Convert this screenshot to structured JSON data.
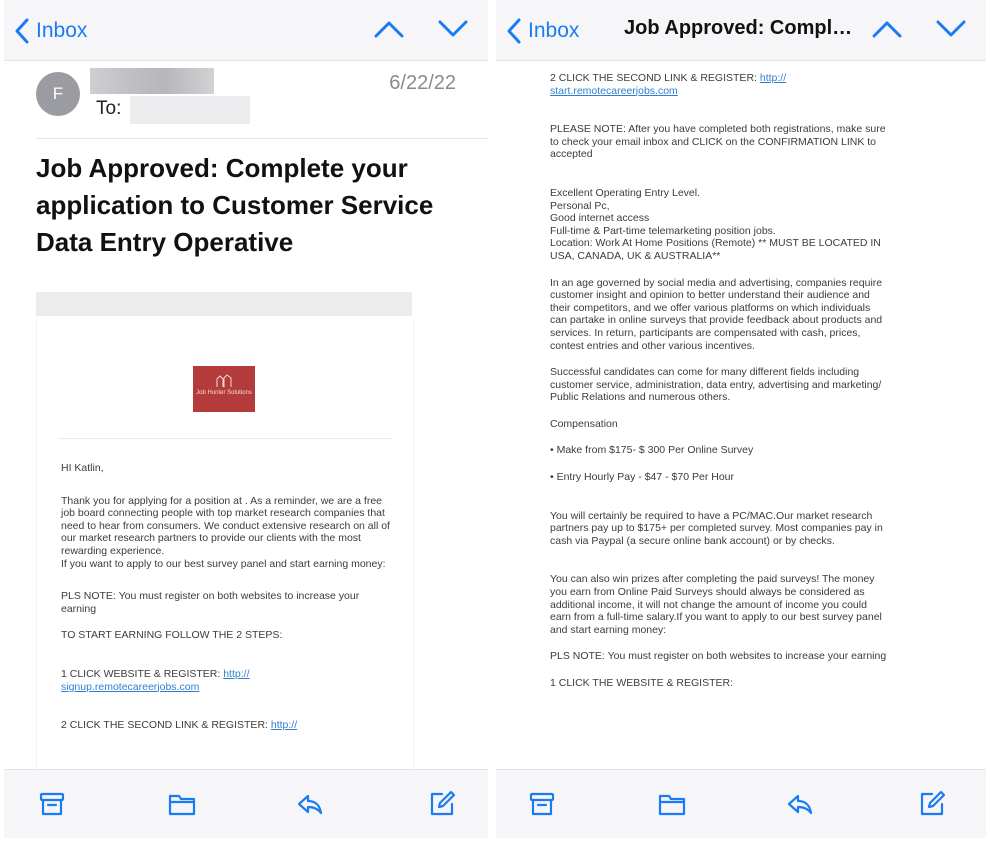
{
  "colors": {
    "accent": "#1a7cf5",
    "link": "#2f7fd0",
    "logo_bg": "#b33b3b"
  },
  "left": {
    "nav": {
      "back_label": "Inbox"
    },
    "header": {
      "avatar_initial": "F",
      "to_label": "To:",
      "date": "6/22/22"
    },
    "subject": "Job Approved: Complete your application to Customer Service Data Entry Operative",
    "logo_text": "Job Hunter Solutions",
    "body": {
      "greeting": "HI Katlin,",
      "intro": "Thank you for applying for a position at . As a reminder, we are a free job board connecting people with top market research companies that need to hear from consumers. We conduct extensive research on all of our market research partners to provide our clients with the most rewarding experience.",
      "intro2": "If you want to apply to our best survey panel and start earning money:",
      "pls_note": "PLS NOTE: You must register on both websites to increase your earning",
      "steps_header": "TO START EARNING FOLLOW THE 2 STEPS:",
      "step1_label": "1 CLICK WEBSITE & REGISTER:",
      "step1_link_a": "http://",
      "step1_link_b": "signup.remotecareerjobs.com",
      "step2_label": "2 CLICK THE SECOND LINK & REGISTER:",
      "step2_link_a": "http://"
    }
  },
  "right": {
    "nav": {
      "back_label": "Inbox",
      "title": "Job Approved: Complete your application to Customer Service Data Entry Operative"
    },
    "body": {
      "step2_label": "2 CLICK THE SECOND LINK & REGISTER:",
      "step2_link_a": "http://",
      "step2_link_b": "start.remotecareerjobs.com",
      "please_note": "PLEASE NOTE: After you have completed both registrations, make sure to check your email inbox and CLICK on the CONFIRMATION LINK to accepted",
      "req_1": "Excellent Operating Entry Level.",
      "req_2": "Personal Pc,",
      "req_3": "Good internet access",
      "req_4": "Full-time & Part-time telemarketing position jobs.",
      "req_5": "Location: Work At Home Positions (Remote) ** MUST BE LOCATED IN USA, CANADA, UK & AUSTRALIA**",
      "para_age": "In an age governed by social media and advertising, companies require customer insight and opinion to better understand their audience and their competitors, and we offer various platforms on which individuals can partake in online surveys that provide feedback about products and services. In return, participants are compensated with cash, prices, contest entries and other various incentives.",
      "para_candidates": "Successful candidates can come for many different fields including customer service, administration, data entry, advertising and marketing/ Public Relations and numerous others.",
      "compensation_header": "Compensation",
      "comp_1": "• Make from $175- $ 300 Per Online Survey",
      "comp_2": "• Entry Hourly Pay - $47 - $70 Per Hour",
      "para_pcmac": "You will certainly be required to have a PC/MAC.Our market research partners pay up to $175+ per completed survey. Most companies pay in cash via Paypal (a secure online bank account) or by checks.",
      "para_prizes": "You can also win prizes after completing the paid surveys! The money you earn from Online Paid Surveys should always be considered as additional income, it will not change the amount of income you could earn from a full-time salary.If you want to apply to our best survey panel and start earning money:",
      "pls_note": "PLS NOTE: You must register on both websites to increase your earning",
      "step1_label": "1 CLICK THE WEBSITE & REGISTER:"
    }
  },
  "toolbar_icons": [
    "archive-icon",
    "folder-icon",
    "reply-icon",
    "compose-icon"
  ]
}
